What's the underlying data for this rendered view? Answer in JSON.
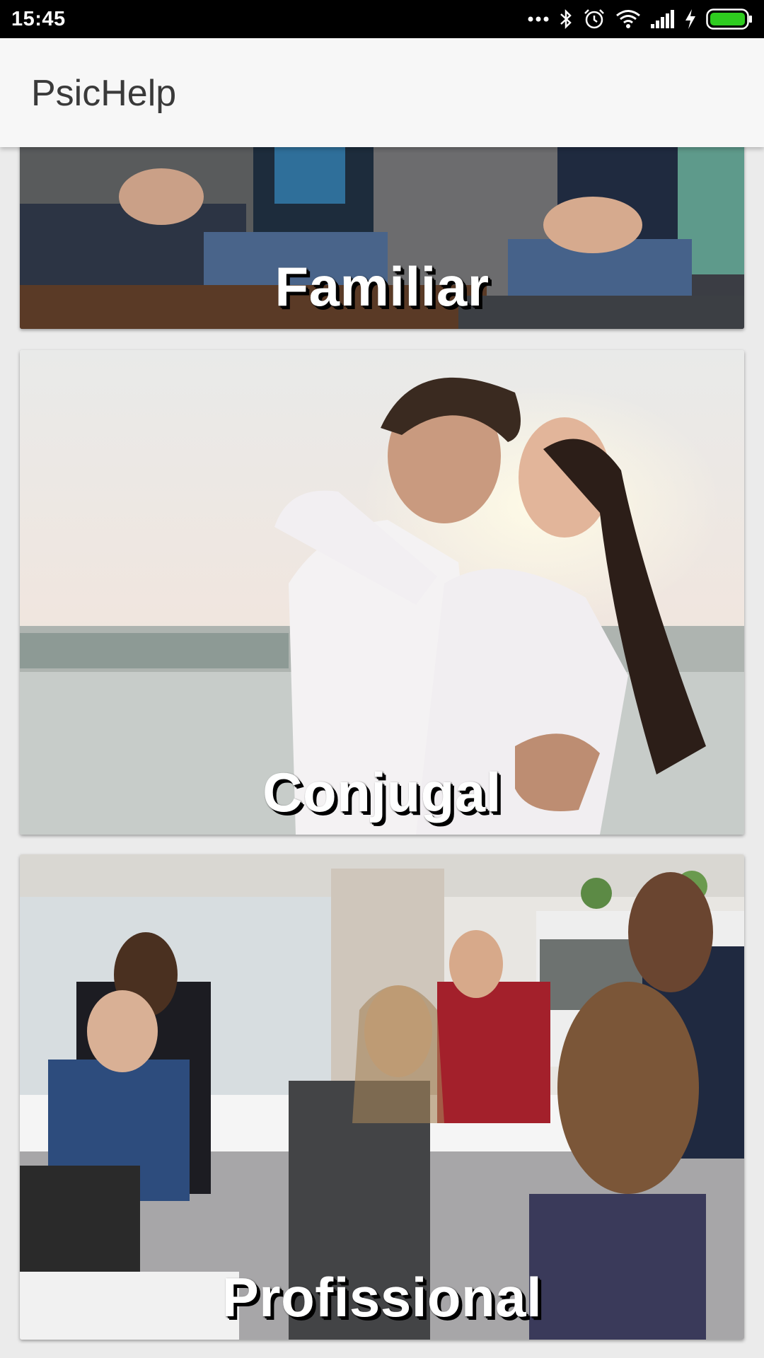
{
  "status_bar": {
    "time": "15:45",
    "icons": [
      "more-dots-icon",
      "bluetooth-icon",
      "alarm-icon",
      "wifi-icon",
      "signal-icon",
      "charging-icon",
      "battery-icon"
    ],
    "battery_color": "#2ecc1f"
  },
  "app_bar": {
    "title": "PsicHelp"
  },
  "categories": [
    {
      "label": "Familiar"
    },
    {
      "label": "Conjugal"
    },
    {
      "label": "Profissional"
    }
  ],
  "colors": {
    "app_bar_bg": "#f7f7f7",
    "list_bg": "#ebebeb",
    "label_text": "#ffffff"
  }
}
